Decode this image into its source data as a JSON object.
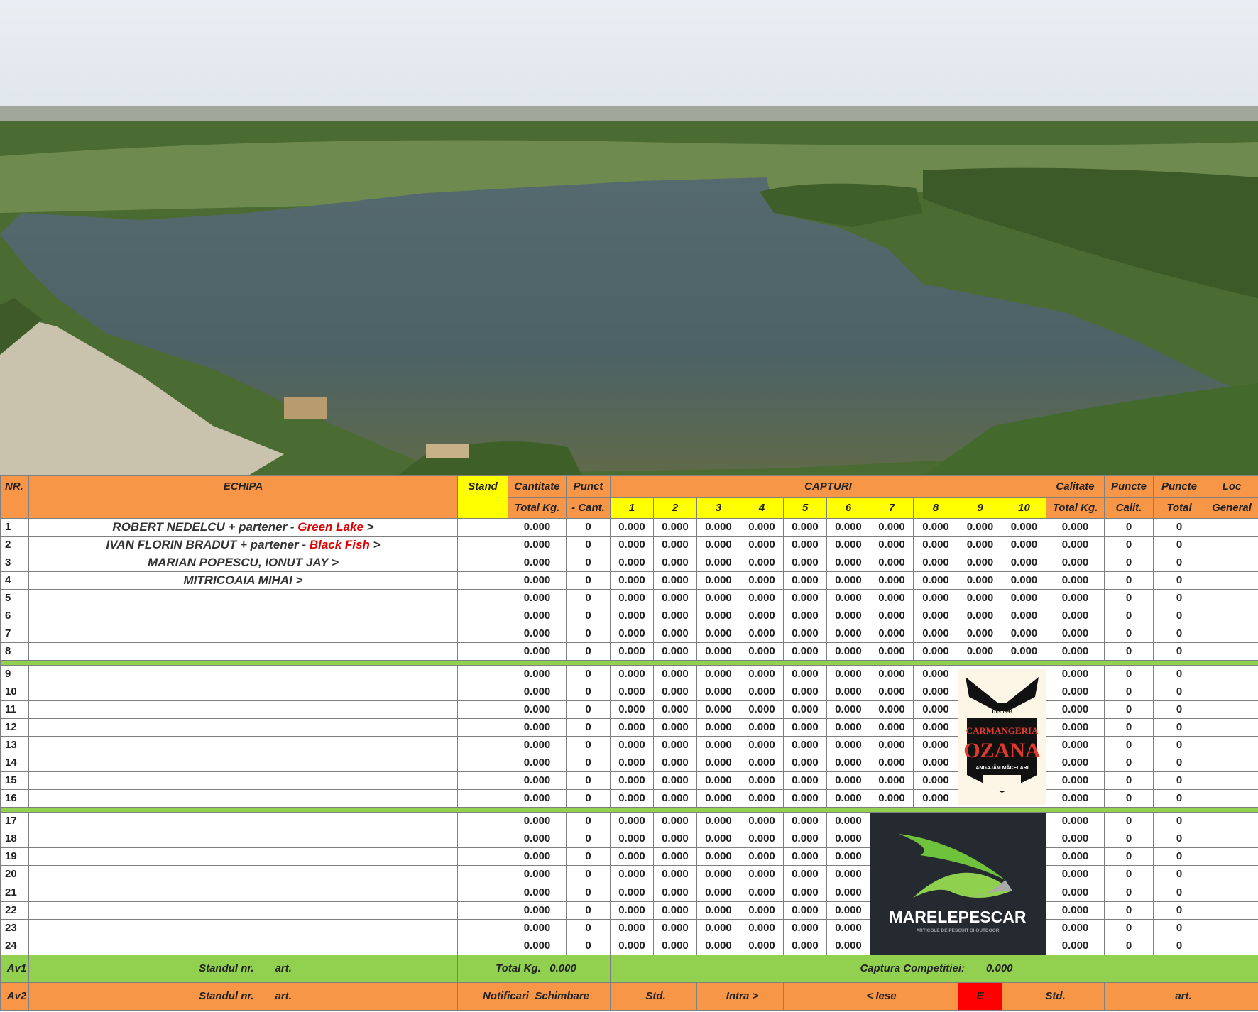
{
  "header": {
    "nr": "NR.",
    "echipa": "ECHIPA",
    "stand": "Stand",
    "cantitate_top": "Cantitate",
    "cantitate_bottom": "Total Kg.",
    "punct_top": "Punct",
    "punct_mid": "-",
    "punct_bottom": "Cant.",
    "capturi": "CAPTURI",
    "capture_cols": [
      "1",
      "2",
      "3",
      "4",
      "5",
      "6",
      "7",
      "8",
      "9",
      "10"
    ],
    "calitate_top": "Calitate",
    "calitate_bottom": "Total Kg.",
    "puncte_calit_top": "Puncte",
    "puncte_calit_bottom": "Calit.",
    "puncte_total_top": "Puncte",
    "puncte_total_bottom": "Total",
    "loc_top": "Loc",
    "loc_bottom": "General"
  },
  "teams": [
    {
      "name": "ROBERT NEDELCU  + partener - ",
      "partner": " Green Lake",
      "suffix": " >"
    },
    {
      "name": "IVAN FLORIN BRADUT  + partener - ",
      "partner": "Black Fish",
      "suffix": " >"
    },
    {
      "name": "MARIAN POPESCU, IONUT JAY",
      "partner": "",
      "suffix": " >"
    },
    {
      "name": "MITRICOAIA MIHAI",
      "partner": "",
      "suffix": " >"
    }
  ],
  "cell_values": {
    "kg": "0.000",
    "points": "0"
  },
  "logos": {
    "ozana_top": "DIN 1993",
    "ozana_line1": "CARMANGERIA",
    "ozana_line2": "OZANA",
    "ozana_sub": "ANGAJĂM MĂCELARI",
    "marele": "MARELE",
    "pescar": "PESCAR",
    "marele_sub": "ARTICOLE DE PESCUIT SI OUTDOOR"
  },
  "footer": {
    "av1": "Av1",
    "av2": "Av2",
    "standul": "Standul nr.",
    "art": "art.",
    "total_kg": "Total Kg.",
    "total_kg_value": "0.000",
    "captura": "Captura Competitiei:",
    "captura_value": "0.000",
    "notificari": "Notificari",
    "schimbare": "Schimbare",
    "std": "Std.",
    "intra": "Intra >",
    "iese": "< Iese",
    "e": "E",
    "std2": "Std.",
    "art2": "art."
  },
  "colors": {
    "header_orange": "#f79646",
    "header_yellow": "#ffff00",
    "separator_green": "#92d050",
    "partner_red": "#e00000"
  }
}
